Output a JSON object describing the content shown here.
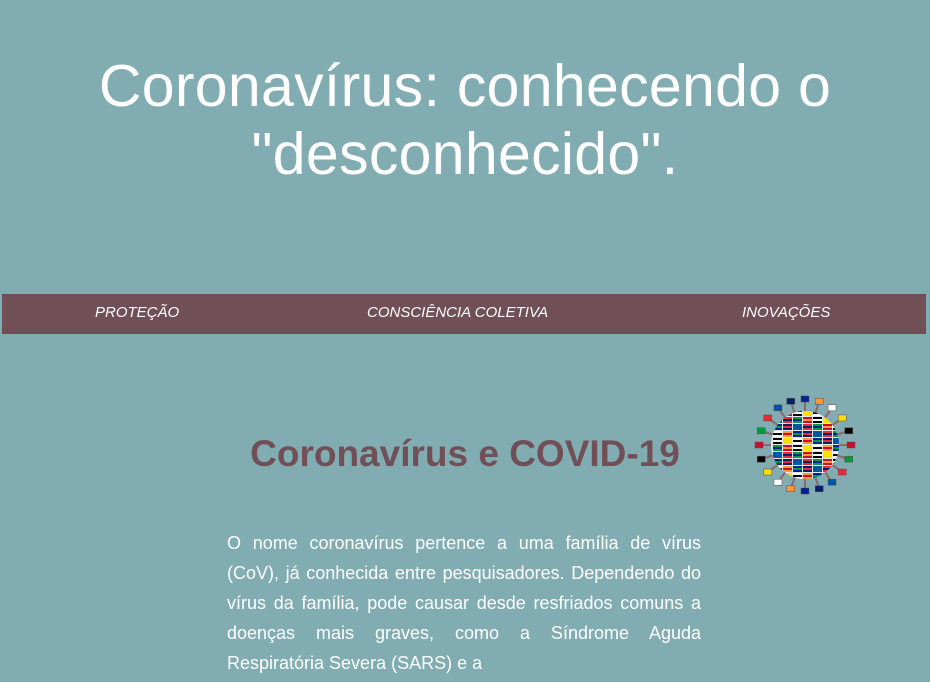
{
  "header": {
    "title_line1": "Coronavírus: conhecendo o",
    "title_line2": "\"desconhecido\"."
  },
  "nav": {
    "items": [
      {
        "label": "PROTEÇÃO"
      },
      {
        "label": "CONSCIÊNCIA COLETIVA"
      },
      {
        "label": "INOVAÇÕES"
      }
    ]
  },
  "main": {
    "heading": "Coronavírus e COVID-19",
    "paragraph": "O nome coronavírus pertence a uma família de vírus (CoV), já conhecida entre pesquisadores. Dependendo do vírus da família, pode causar desde resfriados comuns a doenças mais graves, como a Síndrome Aguda Respiratória Severa (SARS) e a",
    "image": {
      "icon": "virus-flags-icon"
    }
  },
  "colors": {
    "background": "#81adb2",
    "nav_background": "#714f56",
    "heading": "#714f56",
    "text": "#ffffff"
  }
}
